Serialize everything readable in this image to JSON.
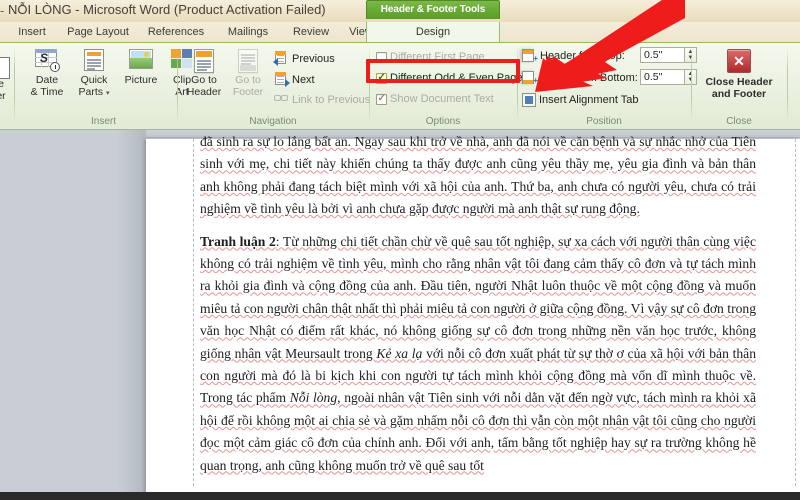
{
  "window": {
    "title": "NỖI LÒNG  -  Microsoft Word (Product Activation Failed)",
    "leading_dash": "-"
  },
  "contextual_tab": {
    "group_title": "Header & Footer Tools",
    "active_tab": "Design"
  },
  "tabs": [
    {
      "label": "Insert",
      "active": false
    },
    {
      "label": "Page Layout",
      "active": false
    },
    {
      "label": "References",
      "active": false
    },
    {
      "label": "Mailings",
      "active": false
    },
    {
      "label": "Review",
      "active": false
    },
    {
      "label": "View",
      "active": false
    },
    {
      "label": "Design",
      "active": true
    }
  ],
  "ribbon": {
    "groups": [
      {
        "name": "header-footer",
        "label": ""
      },
      {
        "name": "insert",
        "label": "Insert"
      },
      {
        "name": "navigation",
        "label": "Navigation"
      },
      {
        "name": "options",
        "label": "Options"
      },
      {
        "name": "position",
        "label": "Position"
      },
      {
        "name": "close",
        "label": "Close"
      }
    ],
    "header_footer_partial": {
      "label_line1": "e",
      "label_line2": "er",
      "caret": "▾"
    },
    "insert": {
      "date_time": {
        "line1": "Date",
        "line2": "& Time"
      },
      "quick_parts": {
        "line1": "Quick",
        "line2": "Parts",
        "caret": "▾"
      },
      "picture": {
        "line1": "Picture",
        "line2": ""
      },
      "clip_art": {
        "line1": "Clip",
        "line2": "Art"
      }
    },
    "navigation": {
      "go_to_header": {
        "line1": "Go to",
        "line2": "Header",
        "enabled": true
      },
      "go_to_footer": {
        "line1": "Go to",
        "line2": "Footer",
        "enabled": false
      },
      "previous": {
        "label": "Previous",
        "enabled": true
      },
      "next": {
        "label": "Next",
        "enabled": true
      },
      "link_to_previous": {
        "label": "Link to Previous",
        "enabled": false
      }
    },
    "options": {
      "different_first_page": {
        "label": "Different First Page",
        "checked": false,
        "enabled": false
      },
      "different_odd_even_pages": {
        "label": "Different Odd & Even Pages",
        "checked": true,
        "enabled": true
      },
      "show_document_text": {
        "label": "Show Document Text",
        "checked": true,
        "enabled": false
      }
    },
    "position": {
      "header_from_top": {
        "label": "Header from Top:",
        "value": "0.5\""
      },
      "footer_from_bottom": {
        "label": "Footer from Bottom:",
        "value": "0.5\""
      },
      "insert_alignment_tab": {
        "label": "Insert Alignment Tab"
      },
      "spinner_up": "▲",
      "spinner_down": "▼"
    },
    "close": {
      "button": {
        "line1": "Close Header",
        "line2": "and Footer"
      }
    }
  },
  "document": {
    "paragraphs": [
      {
        "id": "p1",
        "runs": [
          {
            "text": "đã sinh ra sự lo lắng bất an. Ngay sau khi trở về nhà, anh đã nói về căn bệnh và sự nhắc nhở của Tiên sinh với mẹ, chi tiết này khiến chúng ta thấy được anh cũng yêu thầy mẹ, yêu gia đình và bản thân anh không phải đang tách biệt mình với xã hội của anh. Thứ ba, anh chưa có người yêu, chưa có trải nghiệm về tình yêu là bởi vì anh chưa gặp được người mà anh thật sự rung động.",
            "style": "normal"
          }
        ]
      },
      {
        "id": "p2",
        "runs": [
          {
            "text": "Tranh luận 2",
            "style": "bold"
          },
          {
            "text": ": Từ những chi tiết chần chừ về quê sau tốt nghiệp, sự xa cách với người thân cùng việc không có trải nghiệm về tình yêu, mình cho rằng nhân vật tôi đang cảm thấy cô đơn và tự tách mình ra khỏi gia đình và cộng đồng của anh. Đầu tiên, người Nhật luôn thuộc về một cộng đồng và muốn miêu tả con người chân thật nhất thì phải miêu tả con người ở giữa cộng đồng. Vì vậy sự cô đơn trong văn học Nhật có điểm rất khác, nó không giống sự cô đơn trong những nền văn học trước, không giống nhân vật Meursault trong ",
            "style": "normal"
          },
          {
            "text": "Kẻ xa lạ",
            "style": "italic"
          },
          {
            "text": " với nỗi cô đơn xuất phát từ sự thờ ơ của xã hội với bản thân con người  mà đó là bi kịch khi con người tự tách mình khỏi cộng đồng mà vốn dĩ mình thuộc về. Trong tác phẩm ",
            "style": "normal"
          },
          {
            "text": "Nỗi lòng",
            "style": "italic"
          },
          {
            "text": ", ngoài nhân vật Tiên sinh với nỗi dằn vặt đến ngờ vực, tách mình ra khỏi xã hội để rồi không một ai chia sẻ và gặm nhấm nỗi cô đơn thì vẫn còn một nhân vật tôi cũng cho người đọc một cảm giác cô đơn của chính anh. Đối với anh, tấm bằng tốt nghiệp hay sự ra trường không hề quan trọng, anh cũng không muốn trở về quê sau tốt",
            "style": "normal"
          }
        ]
      }
    ]
  },
  "annotations": {
    "highlight_box_label": "Different Odd & Even Pages highlight",
    "arrow_label": "red pointer arrow",
    "accent_red": "#ef1c1c",
    "accent_green": "#69aa36",
    "highlight_color": "#ef1c1c"
  }
}
